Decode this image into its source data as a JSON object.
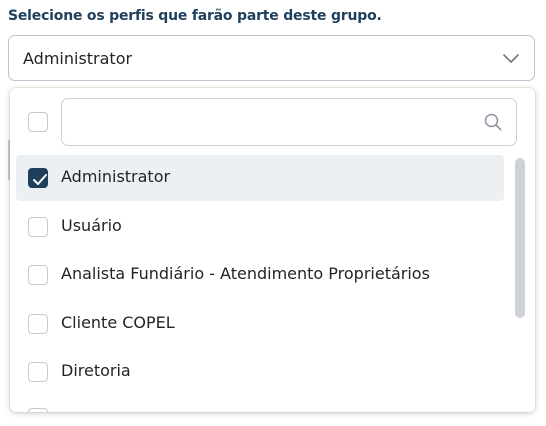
{
  "field": {
    "label": "Selecione os perfis que farão parte deste grupo.",
    "selected_value": "Administrator"
  },
  "dropdown": {
    "search": {
      "value": "",
      "placeholder": ""
    },
    "select_all_checked": false,
    "options": [
      {
        "label": "Administrator",
        "checked": true
      },
      {
        "label": "Usuário",
        "checked": false
      },
      {
        "label": "Analista Fundiário - Atendimento Proprietários",
        "checked": false
      },
      {
        "label": "Cliente COPEL",
        "checked": false
      },
      {
        "label": "Diretoria",
        "checked": false
      }
    ]
  },
  "icons": {
    "select_toggle": "chevron-down-icon",
    "search": "search-icon",
    "check": "check-icon"
  },
  "colors": {
    "label_text": "#1f3f5c",
    "checkbox_checked": "#1f3f5c",
    "selected_row_bg": "#edf0f3",
    "border": "#b8c4cf"
  }
}
